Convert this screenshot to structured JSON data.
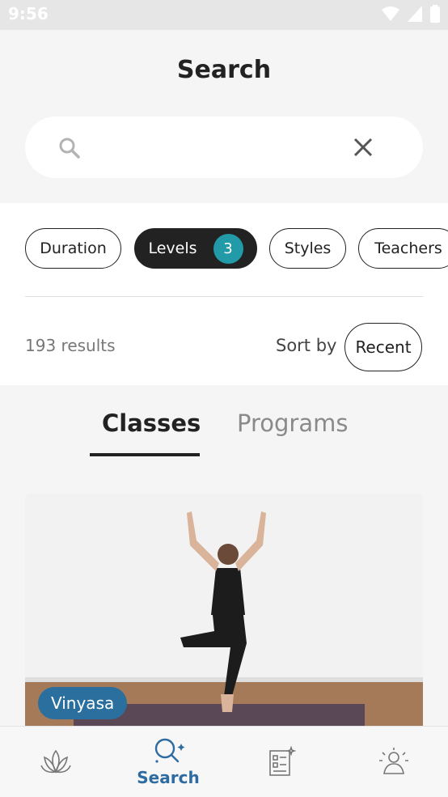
{
  "status_bar": {
    "time": "9:56"
  },
  "header": {
    "title": "Search",
    "search": {
      "value": "",
      "placeholder": ""
    }
  },
  "filters": {
    "chips": [
      {
        "label": "Duration"
      },
      {
        "label": "Levels",
        "count": "3"
      },
      {
        "label": "Styles"
      },
      {
        "label": "Teachers"
      }
    ],
    "results_text": "193 results",
    "sort_label": "Sort by",
    "sort_value": "Recent"
  },
  "tabs": [
    {
      "label": "Classes",
      "active": true
    },
    {
      "label": "Programs",
      "active": false
    }
  ],
  "card": {
    "style": "Vinyasa"
  },
  "bottom_nav": {
    "items": [
      {
        "icon": "lotus-icon",
        "label": ""
      },
      {
        "icon": "search-sparkle-icon",
        "label": "Search",
        "active": true
      },
      {
        "icon": "checklist-icon",
        "label": ""
      },
      {
        "icon": "meditation-icon",
        "label": ""
      }
    ]
  },
  "colors": {
    "accent": "#229aa7",
    "brand": "#2d6ba0",
    "badge": "#2a6f9e"
  }
}
